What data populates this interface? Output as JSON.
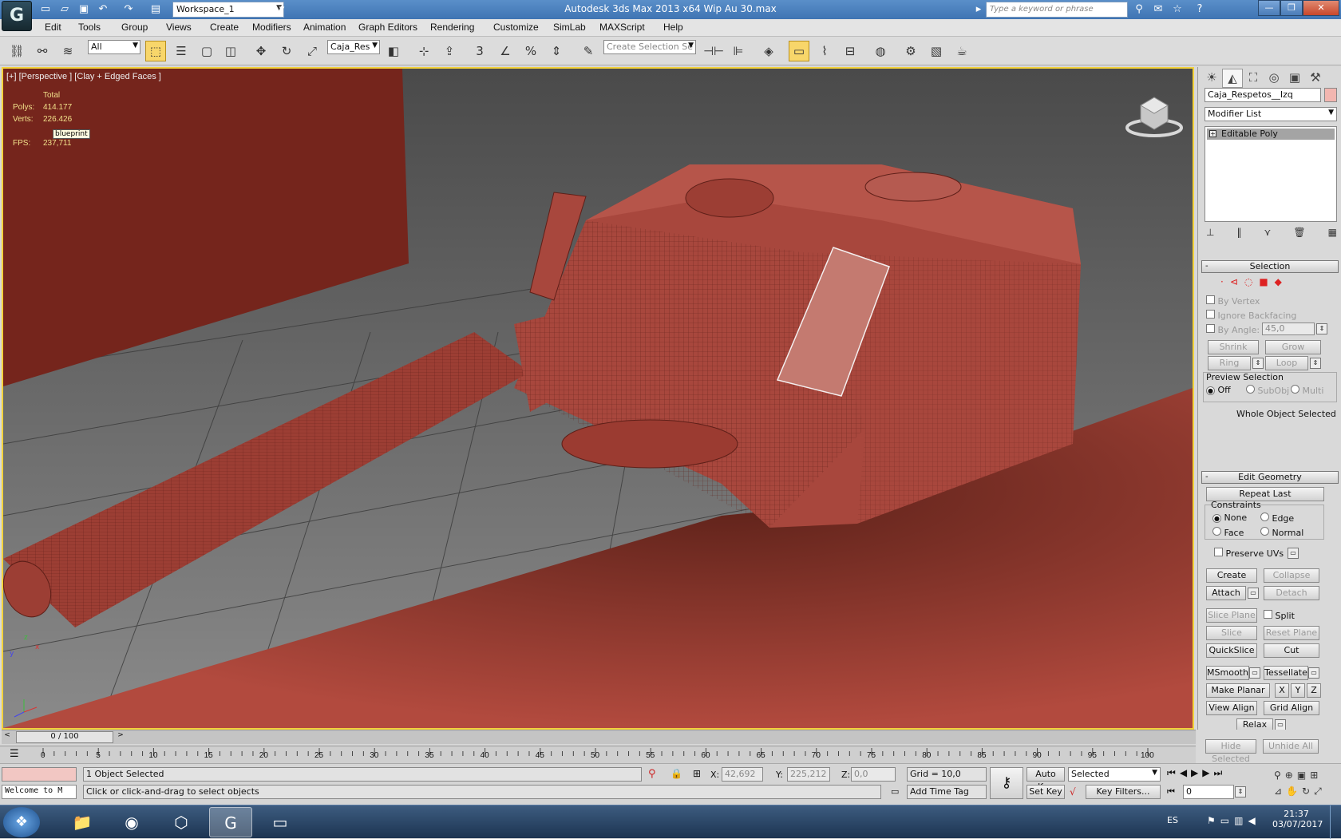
{
  "title_bar": {
    "workspace": "Workspace_1",
    "title": "Autodesk 3ds Max  2013 x64     Wip Au 30.max",
    "search_placeholder": "Type a keyword or phrase"
  },
  "menu": [
    "Edit",
    "Tools",
    "Group",
    "Views",
    "Create",
    "Modifiers",
    "Animation",
    "Graph Editors",
    "Rendering",
    "Customize",
    "SimLab",
    "MAXScript",
    "Help"
  ],
  "toolbar": {
    "filter": "All",
    "named_set": "Caja_Res",
    "selection_set_placeholder": "Create Selection Se"
  },
  "viewport": {
    "label": "[+] [Perspective ] [Clay + Edged Faces ]",
    "stats_header": "Total",
    "polys_label": "Polys:",
    "polys_value": "414.177",
    "verts_label": "Verts:",
    "verts_value": "226.426",
    "fps_label": "FPS:",
    "fps_value": "237,711",
    "tooltip": "blueprint",
    "axis_x": "x",
    "axis_y": "y",
    "axis_z": "z"
  },
  "command_panel": {
    "object_name": "Caja_Respetos__Izq",
    "modifier_list": "Modifier List",
    "stack_item": "Editable Poly",
    "selection": {
      "title": "Selection",
      "by_vertex": "By Vertex",
      "ignore_backfacing": "Ignore Backfacing",
      "by_angle": "By Angle:",
      "angle_value": "45,0",
      "shrink": "Shrink",
      "grow": "Grow",
      "ring": "Ring",
      "loop": "Loop",
      "preview_selection": "Preview Selection",
      "off": "Off",
      "subobj": "SubObj",
      "multi": "Multi",
      "status": "Whole Object Selected"
    },
    "edit_geometry": {
      "title": "Edit Geometry",
      "repeat_last": "Repeat Last",
      "constraints": "Constraints",
      "none": "None",
      "edge": "Edge",
      "face": "Face",
      "normal": "Normal",
      "preserve_uvs": "Preserve UVs",
      "create": "Create",
      "collapse": "Collapse",
      "attach": "Attach",
      "detach": "Detach",
      "slice_plane": "Slice Plane",
      "split": "Split",
      "slice": "Slice",
      "reset_plane": "Reset Plane",
      "quickslice": "QuickSlice",
      "cut": "Cut",
      "msmooth": "MSmooth",
      "tessellate": "Tessellate",
      "make_planar": "Make Planar",
      "x": "X",
      "y": "Y",
      "z": "Z",
      "view_align": "View Align",
      "grid_align": "Grid Align",
      "relax": "Relax",
      "hide_selected": "Hide Selected",
      "unhide_all": "Unhide All"
    }
  },
  "timeline": {
    "frame": "0 / 100",
    "ticks": [
      "0",
      "5",
      "10",
      "15",
      "20",
      "25",
      "30",
      "35",
      "40",
      "45",
      "50",
      "55",
      "60",
      "65",
      "70",
      "75",
      "80",
      "85",
      "90",
      "95",
      "100"
    ]
  },
  "status": {
    "script_listener": "Welcome to M",
    "selected": "1 Object Selected",
    "prompt": "Click or click-and-drag to select objects",
    "x_label": "X:",
    "x_value": "42,692",
    "y_label": "Y:",
    "y_value": "225,212",
    "z_label": "Z:",
    "z_value": "0,0",
    "grid": "Grid = 10,0",
    "add_time_tag": "Add Time Tag",
    "auto_key": "Auto Key",
    "set_key": "Set Key",
    "key_mode": "Selected",
    "key_filters": "Key Filters...",
    "current_frame": "0"
  },
  "taskbar": {
    "lang": "ES",
    "time": "21:37",
    "date": "03/07/2017"
  },
  "colors": {
    "viewport_border": "#f3d23b",
    "model": "#a8473d",
    "backdrop": "#75251c",
    "titlebar": "#4a80bf"
  }
}
